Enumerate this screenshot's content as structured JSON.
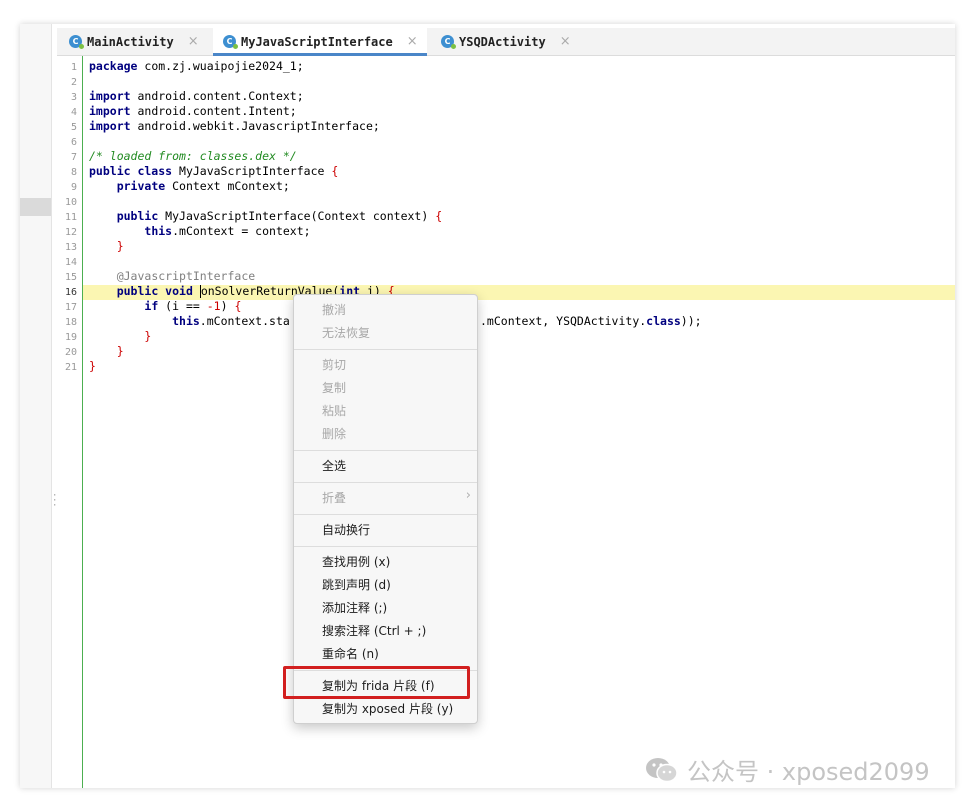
{
  "tabs": [
    {
      "label": "MainActivity",
      "icon": "class-icon",
      "close": "×"
    },
    {
      "label": "MyJavaScriptInterface",
      "icon": "class-icon",
      "close": "×",
      "active": true
    },
    {
      "label": "YSQDActivity",
      "icon": "class-icon",
      "close": "×"
    }
  ],
  "editor": {
    "line_numbers": [
      "1",
      "2",
      "3",
      "4",
      "5",
      "6",
      "7",
      "8",
      "9",
      "10",
      "11",
      "12",
      "13",
      "14",
      "15",
      "16",
      "17",
      "18",
      "19",
      "20",
      "21"
    ],
    "current_line": "16",
    "lines": {
      "l1": {
        "kw": "package",
        "rest": " com.zj.wuaipojie2024_1;"
      },
      "l3": {
        "kw": "import",
        "rest": " android.content.Context;"
      },
      "l4": {
        "kw": "import",
        "rest": " android.content.Intent;"
      },
      "l5": {
        "kw": "import",
        "rest": " android.webkit.JavascriptInterface;"
      },
      "l7": {
        "comment": "/* loaded from: classes.dex */"
      },
      "l8": {
        "kw": "public class",
        "rest": " MyJavaScriptInterface ",
        "brace": "{"
      },
      "l9": {
        "indent": "    ",
        "kw": "private",
        "rest": " Context mContext;"
      },
      "l11": {
        "indent": "    ",
        "kw": "public",
        "rest": " MyJavaScriptInterface(Context context) ",
        "brace": "{"
      },
      "l12": {
        "indent": "        ",
        "kw": "this",
        "rest": ".mContext = context;"
      },
      "l13": {
        "indent": "    ",
        "brace": "}"
      },
      "l15": {
        "indent": "    ",
        "annotation": "@JavascriptInterface"
      },
      "l16": {
        "indent": "    ",
        "kw": "public void",
        "pre": " ",
        "rest": "onSolverReturnValue(",
        "kw2": "int",
        "rest2": " i) ",
        "brace": "{"
      },
      "l17": {
        "indent": "        ",
        "kw": "if",
        "rest": " (i == ",
        "num": "-1",
        "rest2": ") ",
        "brace": "{"
      },
      "l18": {
        "indent": "            ",
        "kw": "this",
        "rest": ".mContext.sta",
        "tail": ".mContext, YSQDActivity.",
        "kw2": "class",
        "rest2": "));"
      },
      "l19": {
        "indent": "        ",
        "brace": "}"
      },
      "l20": {
        "indent": "    ",
        "brace": "}"
      },
      "l21": {
        "brace": "}"
      }
    }
  },
  "context_menu": {
    "undo": "撤消",
    "redo": "无法恢复",
    "cut": "剪切",
    "copy": "复制",
    "paste": "粘贴",
    "delete": "删除",
    "select_all": "全选",
    "fold": "折叠",
    "word_wrap": "自动换行",
    "find_usages": "查找用例 (x)",
    "goto_decl": "跳到声明 (d)",
    "add_comment": "添加注释 (;)",
    "search_comment": "搜索注释 (Ctrl + ;)",
    "rename": "重命名 (n)",
    "copy_frida": "复制为 frida 片段 (f)",
    "copy_xposed": "复制为 xposed 片段 (y)"
  },
  "watermark": {
    "text": "公众号 · xposed2099"
  },
  "colors": {
    "accent": "#4a86c8",
    "highlight_line": "#fbf6b2",
    "red_box": "#d21f1f",
    "keyword": "#00007f"
  }
}
